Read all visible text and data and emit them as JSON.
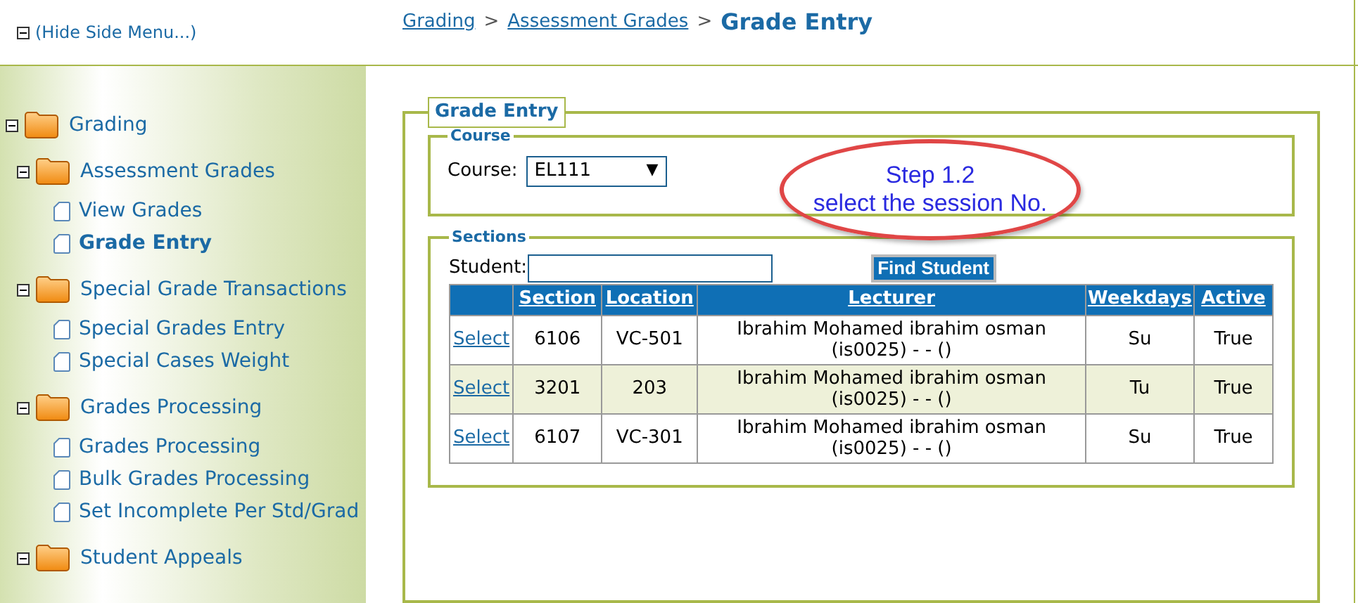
{
  "side_menu_toggle": {
    "label": "(Hide Side Menu...)",
    "expanded": true
  },
  "sidebar": {
    "tree": [
      {
        "label": "Grading",
        "expanded": true,
        "children": [
          {
            "label": "Assessment Grades",
            "expanded": true,
            "children": [
              {
                "label": "View Grades",
                "selected": false
              },
              {
                "label": "Grade Entry",
                "selected": true
              }
            ]
          },
          {
            "label": "Special Grade Transactions",
            "expanded": true,
            "children": [
              {
                "label": "Special Grades Entry",
                "selected": false
              },
              {
                "label": "Special Cases Weight",
                "selected": false
              }
            ]
          },
          {
            "label": "Grades Processing",
            "expanded": true,
            "children": [
              {
                "label": "Grades Processing",
                "selected": false
              },
              {
                "label": "Bulk Grades Processing",
                "selected": false
              },
              {
                "label": "Set Incomplete Per Std/Grad",
                "selected": false
              }
            ]
          },
          {
            "label": "Student Appeals",
            "expanded": true
          }
        ]
      }
    ]
  },
  "breadcrumb": {
    "links": [
      "Grading",
      "Assessment Grades"
    ],
    "separator": ">",
    "current": "Grade Entry"
  },
  "grade_entry": {
    "legend": "Grade Entry",
    "course": {
      "legend": "Course",
      "label": "Course:",
      "value": "EL111",
      "arrow": "▼"
    },
    "annotation": {
      "lines": [
        "Step 1.2",
        "select the session No."
      ]
    },
    "sections": {
      "legend": "Sections",
      "student_label": "Student:",
      "find_button": "Find Student",
      "table": {
        "columns": [
          "",
          "Section",
          "Location",
          "Lecturer",
          "Weekdays",
          "Active"
        ],
        "rows": [
          {
            "action": "Select",
            "section": "6106",
            "location": "VC-501",
            "lecturer": "Ibrahim Mohamed ibrahim osman (is0025) - - ()",
            "weekdays": "Su",
            "active": "True"
          },
          {
            "action": "Select",
            "section": "3201",
            "location": "203",
            "lecturer": "Ibrahim Mohamed ibrahim osman (is0025) - - ()",
            "weekdays": "Tu",
            "active": "True"
          },
          {
            "action": "Select",
            "section": "6107",
            "location": "VC-301",
            "lecturer": "Ibrahim Mohamed ibrahim osman (is0025) - - ()",
            "weekdays": "Su",
            "active": "True"
          }
        ]
      }
    }
  }
}
